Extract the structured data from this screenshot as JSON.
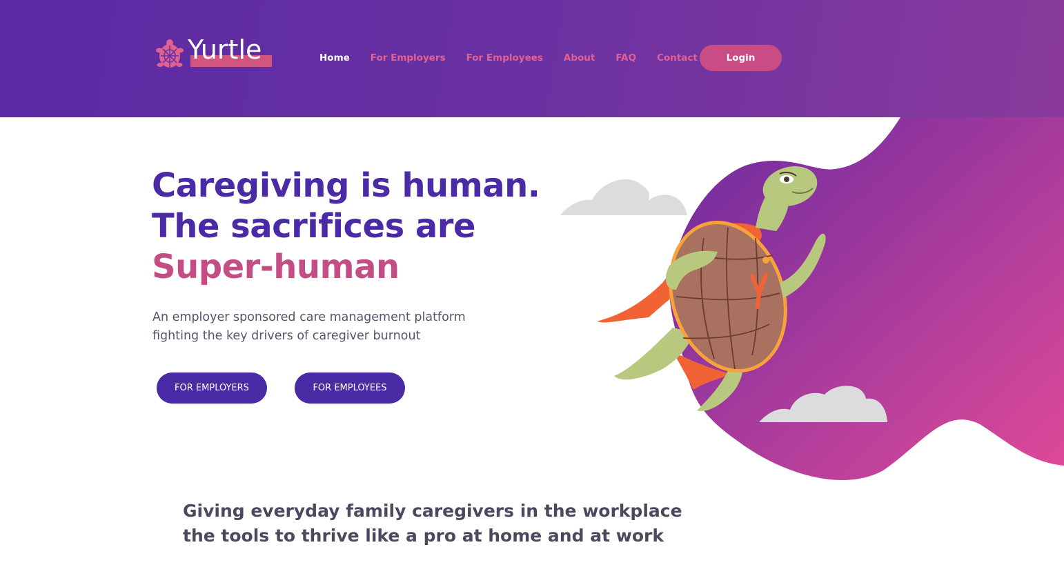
{
  "brand": {
    "name": "Yurtle",
    "accent": "#d1557e",
    "primary": "#4b2aa6"
  },
  "nav": {
    "items": [
      {
        "label": "Home",
        "active": true
      },
      {
        "label": "For Employers",
        "active": false
      },
      {
        "label": "For Employees",
        "active": false
      },
      {
        "label": "About",
        "active": false
      },
      {
        "label": "FAQ",
        "active": false
      },
      {
        "label": "Contact",
        "active": false
      }
    ],
    "login_label": "Login"
  },
  "hero": {
    "headline_line1": "Caregiving is human.",
    "headline_line2": "The sacrifices are",
    "headline_line3": "Super-human",
    "subtext": "An employer sponsored care management platform fighting the key drivers of caregiver burnout",
    "cta_employers": "FOR EMPLOYERS",
    "cta_employees": "FOR EMPLOYEES",
    "illustration": "superhero-turtle-icon"
  },
  "tagline": "Giving everyday family caregivers in the workplace the tools to thrive like a pro at home and at work"
}
